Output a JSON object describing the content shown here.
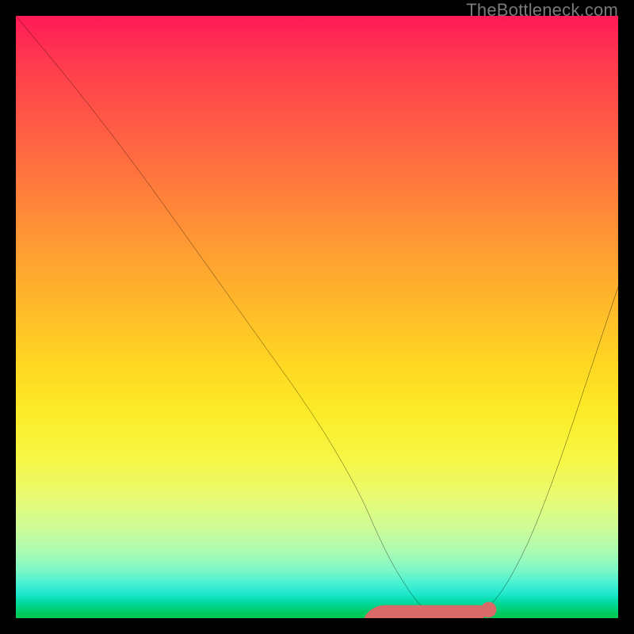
{
  "watermark": "TheBottleneck.com",
  "chart_data": {
    "type": "line",
    "title": "",
    "xlabel": "",
    "ylabel": "",
    "xlim": [
      0,
      100
    ],
    "ylim": [
      0,
      100
    ],
    "gradient_stops": [
      {
        "pos": 0,
        "color": "#ff1a57"
      },
      {
        "pos": 50,
        "color": "#ffcf25"
      },
      {
        "pos": 75,
        "color": "#f3f850"
      },
      {
        "pos": 90,
        "color": "#9efabc"
      },
      {
        "pos": 100,
        "color": "#00c850"
      }
    ],
    "series": [
      {
        "name": "bottleneck-curve",
        "color": "#000000",
        "x": [
          0,
          10,
          20,
          30,
          40,
          50,
          57,
          60,
          63,
          67,
          70,
          73,
          76,
          80,
          85,
          90,
          95,
          100
        ],
        "y": [
          100,
          88,
          75,
          61,
          47,
          33,
          21,
          14,
          8,
          2,
          0,
          0,
          0,
          3,
          12,
          25,
          40,
          55
        ]
      },
      {
        "name": "sweet-spot-band",
        "color": "#d96a6a",
        "type": "band",
        "x": [
          59,
          79
        ],
        "y": [
          0,
          0
        ],
        "thickness": 2.3
      },
      {
        "name": "sweet-spot-marker",
        "color": "#d96a6a",
        "type": "point",
        "x": [
          78.5
        ],
        "y": [
          1.4
        ],
        "size": 1.3
      }
    ]
  }
}
